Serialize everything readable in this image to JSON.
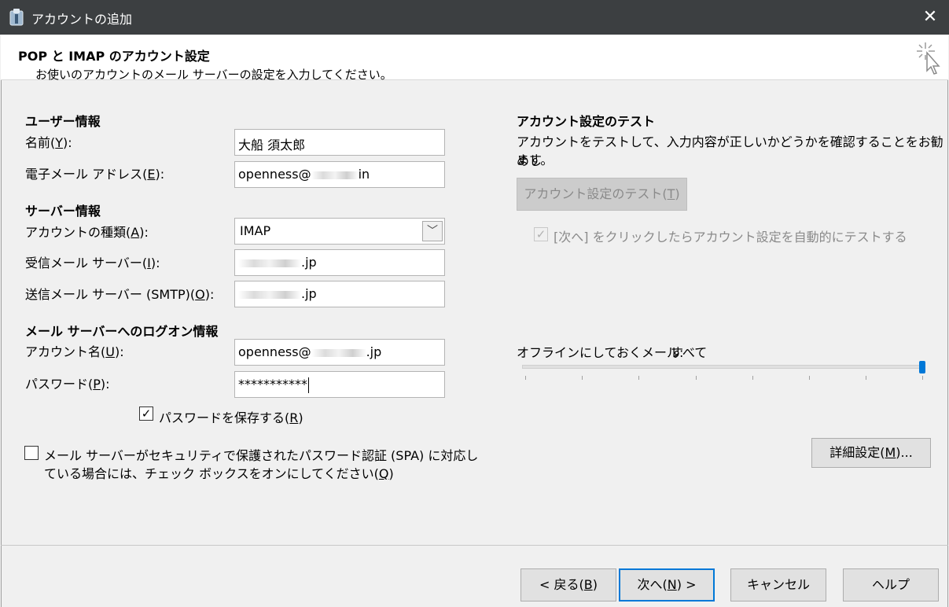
{
  "window": {
    "title": "アカウントの追加"
  },
  "header": {
    "title": "POP と IMAP のアカウント設定",
    "subtitle": "お使いのアカウントのメール サーバーの設定を入力してください。"
  },
  "user_info": {
    "section": "ユーザー情報",
    "name_label": "名前(",
    "name_key": "Y",
    "name_value": "大船 須太郎",
    "email_label": "電子メール アドレス(",
    "email_key": "E",
    "email_value_prefix": "openness@",
    "email_value_suffix": "in"
  },
  "server_info": {
    "section": "サーバー情報",
    "account_type_label": "アカウントの種類(",
    "account_type_key": "A",
    "account_type_value": "IMAP",
    "incoming_label": "受信メール サーバー(",
    "incoming_key": "I",
    "incoming_value_suffix": ".jp",
    "outgoing_label": "送信メール サーバー (SMTP)(",
    "outgoing_key": "O",
    "outgoing_value_suffix": ".jp"
  },
  "logon_info": {
    "section": "メール サーバーへのログオン情報",
    "account_name_label": "アカウント名(",
    "account_name_key": "U",
    "account_name_prefix": "openness@",
    "account_name_suffix": ".jp",
    "password_label": "パスワード(",
    "password_key": "P",
    "password_value": "***********",
    "save_password_label": "パスワードを保存する(",
    "save_password_key": "R",
    "spa_label_line1": "メール サーバーがセキュリティで保護されたパスワード認証 (SPA) に対応し",
    "spa_label_line2": "ている場合には、チェック ボックスをオンにしてください(",
    "spa_key": "Q"
  },
  "test_section": {
    "title": "アカウント設定のテスト",
    "desc_line1": "アカウントをテストして、入力内容が正しいかどうかを確認することをお勧めし",
    "desc_line2": "ます。",
    "test_button": "アカウント設定のテスト(",
    "test_button_key": "T",
    "auto_test_label": "[次へ] をクリックしたらアカウント設定を自動的にテストする"
  },
  "offline": {
    "label": "オフラインにしておくメール:",
    "value": "すべて",
    "level": 1.0
  },
  "buttons": {
    "advanced": "詳細設定(",
    "advanced_key": "M",
    "advanced_suffix": ")...",
    "back": "< 戻る(",
    "back_key": "B",
    "next": "次へ(",
    "next_key": "N",
    "next_suffix": ") >",
    "cancel": "キャンセル",
    "help": "ヘルプ"
  },
  "state": {
    "save_password_checked": true,
    "spa_checked": false,
    "auto_test_checked": true
  }
}
